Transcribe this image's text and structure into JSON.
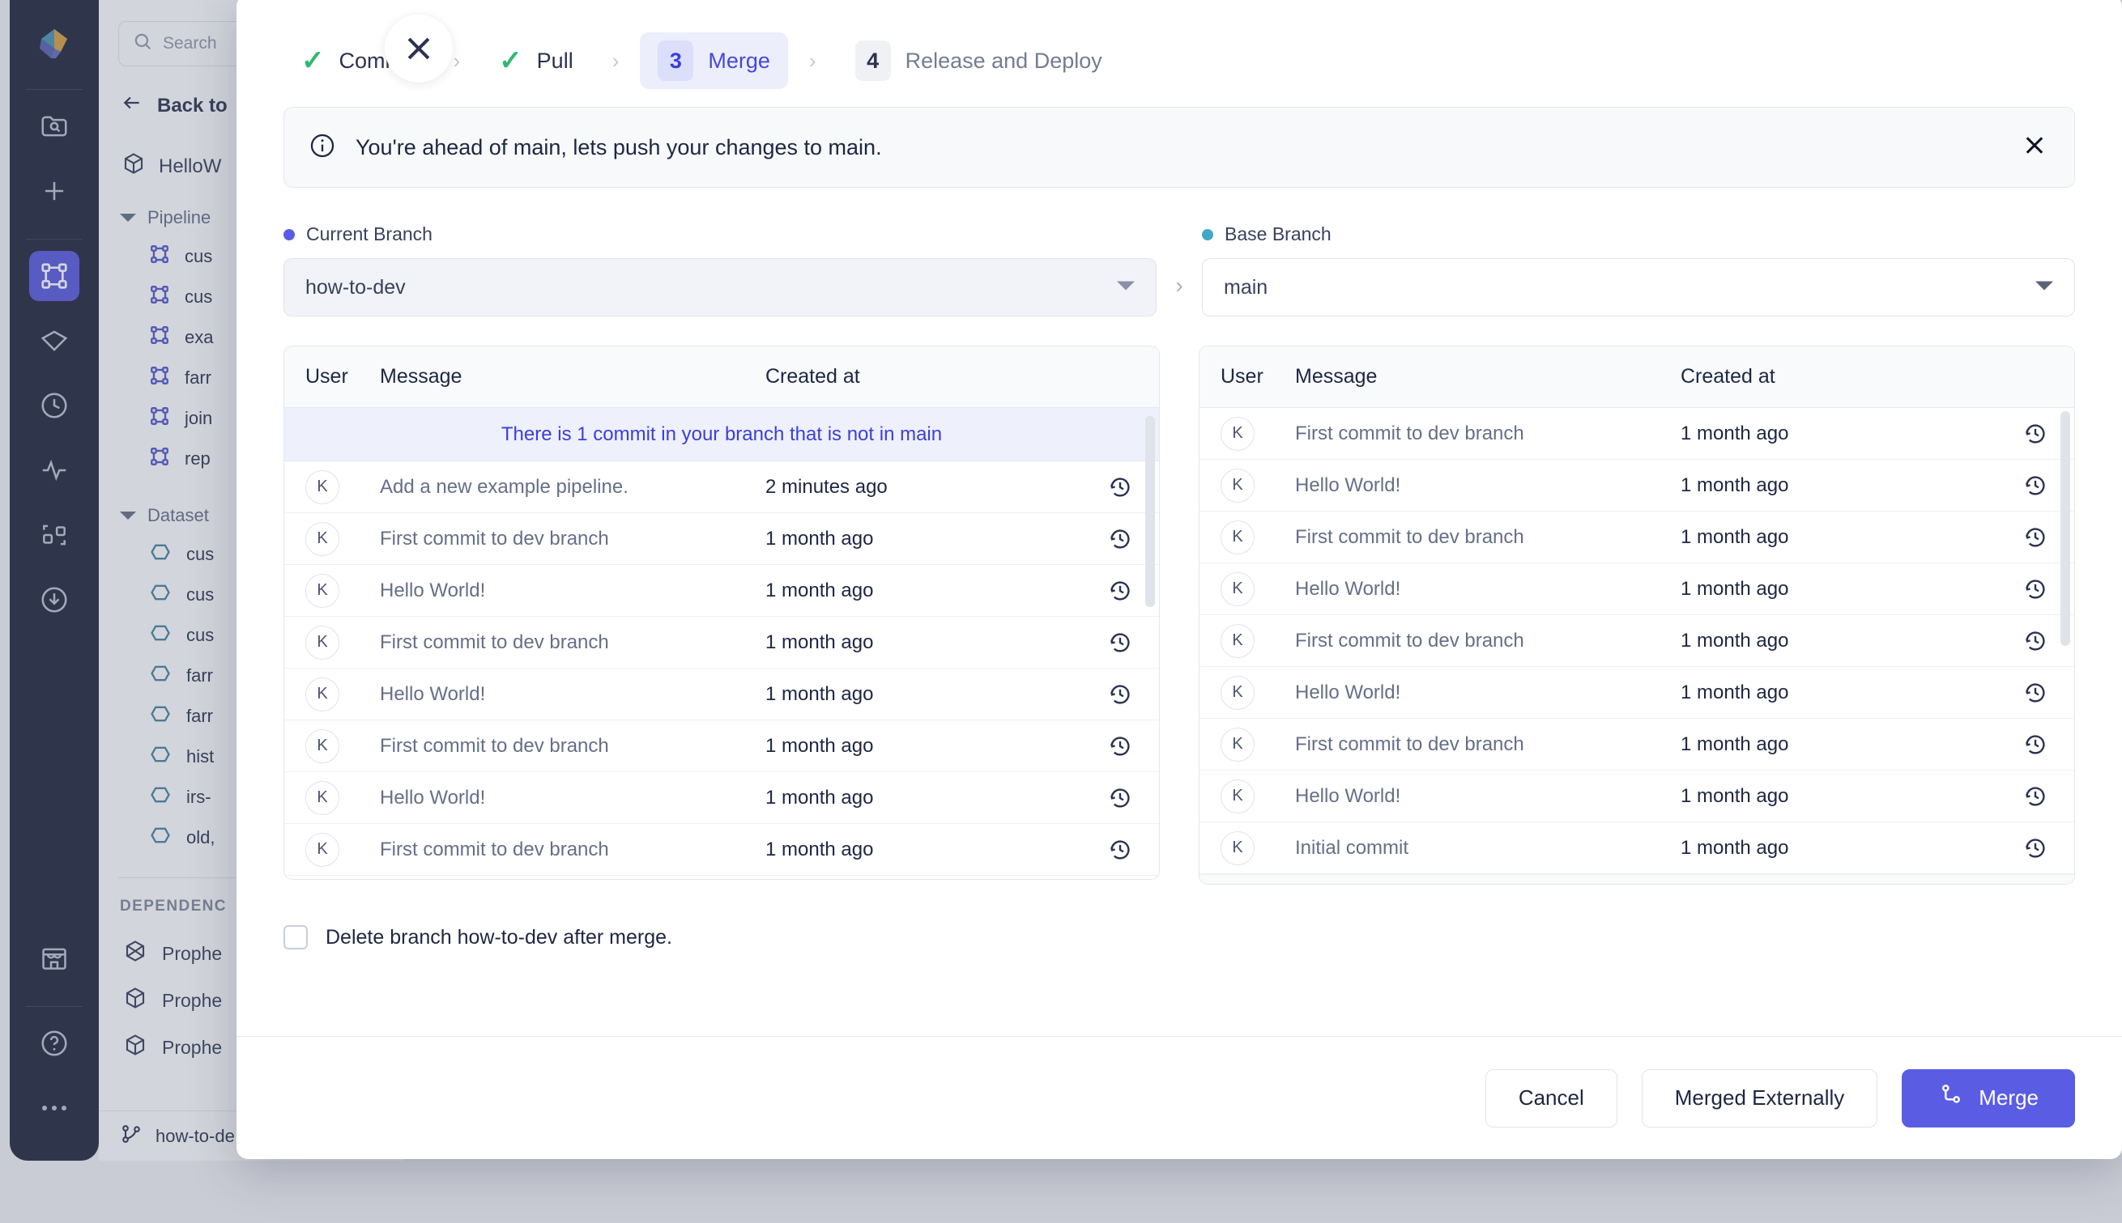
{
  "background": {
    "search": {
      "placeholder": "Search",
      "icon": "search-icon"
    },
    "back_label": "Back to",
    "project": {
      "label": "HelloW",
      "icon": "cube-icon"
    },
    "groups": [
      {
        "label": "Pipeline",
        "icon": "chevron-down-icon"
      },
      {
        "label": "Dataset",
        "icon": "chevron-down-icon"
      }
    ],
    "pipelines": [
      "cus",
      "cus",
      "exa",
      "farr",
      "join",
      "rep"
    ],
    "datasets": [
      "cus",
      "cus",
      "cus",
      "farr",
      "farr",
      "hist",
      "irs-",
      "old,"
    ],
    "dependencies_caption": "DEPENDENC",
    "dependencies": [
      "Prophe",
      "Prophe",
      "Prophe"
    ],
    "branch_footer": "how-to-de",
    "rail_icons": [
      "app-logo-icon",
      "folder-search-icon",
      "plus-icon",
      "pipeline-icon",
      "gem-icon",
      "clock-icon",
      "activity-icon",
      "nodes-icon",
      "download-circle-icon",
      "store-icon",
      "help-circle-icon",
      "more-icon"
    ]
  },
  "modal": {
    "close_icon": "close-icon",
    "stepper": [
      {
        "state": "done",
        "mark": "✓",
        "label": "Commit"
      },
      {
        "state": "done",
        "mark": "✓",
        "label": "Pull"
      },
      {
        "state": "current",
        "mark": "3",
        "label": "Merge"
      },
      {
        "state": "todo",
        "mark": "4",
        "label": "Release and Deploy"
      }
    ],
    "step_arrow": "›",
    "banner": {
      "icon": "info-icon",
      "text": "You're ahead of main, lets push your changes to main.",
      "close_icon": "close-icon"
    },
    "current_branch": {
      "label": "Current Branch",
      "value": "how-to-dev",
      "dot_color": "#5a5de4",
      "caret_icon": "chevron-down-icon"
    },
    "base_branch": {
      "label": "Base Branch",
      "value": "main",
      "dot_color": "#41a8c4",
      "caret_icon": "chevron-down-icon"
    },
    "arrow_between": "›",
    "left_table": {
      "columns": [
        "User",
        "Message",
        "Created at"
      ],
      "notice": "There is 1 commit in your branch that is not in main",
      "rows": [
        {
          "user": "K",
          "message": "Add a new example pipeline.",
          "created_at": "2 minutes ago",
          "action_icon": "history-icon"
        },
        {
          "user": "K",
          "message": "First commit to dev branch",
          "created_at": "1 month ago",
          "action_icon": "history-icon"
        },
        {
          "user": "K",
          "message": "Hello World!",
          "created_at": "1 month ago",
          "action_icon": "history-icon"
        },
        {
          "user": "K",
          "message": "First commit to dev branch",
          "created_at": "1 month ago",
          "action_icon": "history-icon"
        },
        {
          "user": "K",
          "message": "Hello World!",
          "created_at": "1 month ago",
          "action_icon": "history-icon"
        },
        {
          "user": "K",
          "message": "First commit to dev branch",
          "created_at": "1 month ago",
          "action_icon": "history-icon"
        },
        {
          "user": "K",
          "message": "Hello World!",
          "created_at": "1 month ago",
          "action_icon": "history-icon"
        },
        {
          "user": "K",
          "message": "First commit to dev branch",
          "created_at": "1 month ago",
          "action_icon": "history-icon"
        }
      ]
    },
    "right_table": {
      "columns": [
        "User",
        "Message",
        "Created at"
      ],
      "rows": [
        {
          "user": "K",
          "message": "First commit to dev branch",
          "created_at": "1 month ago",
          "action_icon": "history-icon"
        },
        {
          "user": "K",
          "message": "Hello World!",
          "created_at": "1 month ago",
          "action_icon": "history-icon"
        },
        {
          "user": "K",
          "message": "First commit to dev branch",
          "created_at": "1 month ago",
          "action_icon": "history-icon"
        },
        {
          "user": "K",
          "message": "Hello World!",
          "created_at": "1 month ago",
          "action_icon": "history-icon"
        },
        {
          "user": "K",
          "message": "First commit to dev branch",
          "created_at": "1 month ago",
          "action_icon": "history-icon"
        },
        {
          "user": "K",
          "message": "Hello World!",
          "created_at": "1 month ago",
          "action_icon": "history-icon"
        },
        {
          "user": "K",
          "message": "First commit to dev branch",
          "created_at": "1 month ago",
          "action_icon": "history-icon"
        },
        {
          "user": "K",
          "message": "Hello World!",
          "created_at": "1 month ago",
          "action_icon": "history-icon"
        },
        {
          "user": "K",
          "message": "Initial commit",
          "created_at": "1 month ago",
          "action_icon": "history-icon"
        }
      ]
    },
    "delete_branch": {
      "checked": false,
      "label": "Delete branch how-to-dev after merge."
    },
    "footer": {
      "cancel": "Cancel",
      "merged_externally": "Merged Externally",
      "merge": "Merge",
      "merge_icon": "git-merge-icon"
    }
  },
  "colors": {
    "accent": "#5a5de4",
    "accent_text": "#4447e0",
    "success": "#2eb872",
    "rail_bg": "#151c31",
    "notice_bg": "#eef0fc"
  }
}
